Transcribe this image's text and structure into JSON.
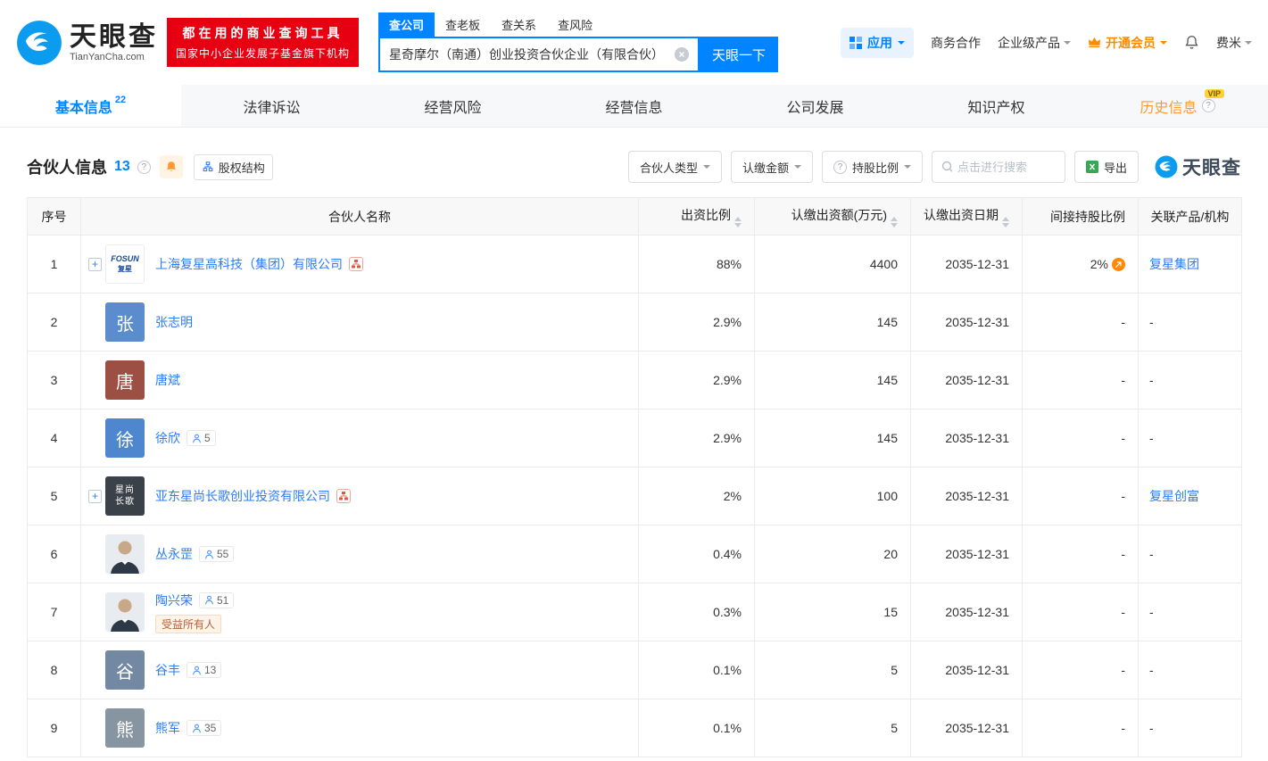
{
  "colors": {
    "primary": "#0084ff",
    "link": "#2b7cf7",
    "brand_red": "#e60012",
    "vip_orange": "#ff8a00"
  },
  "topbar": {
    "logo": {
      "title": "天眼查",
      "subtitle": "TianYanCha.com"
    },
    "slogan": {
      "line1": "都在用的商业查询工具",
      "line2": "国家中小企业发展子基金旗下机构"
    },
    "search": {
      "tabs": [
        {
          "label": "查公司",
          "active": true
        },
        {
          "label": "查老板",
          "active": false
        },
        {
          "label": "查关系",
          "active": false
        },
        {
          "label": "查风险",
          "active": false
        }
      ],
      "value": "星奇摩尔（南通）创业投资合伙企业（有限合伙）",
      "button_label": "天眼一下"
    },
    "right": {
      "apps_label": "应用",
      "biz_label": "商务合作",
      "enterprise_label": "企业级产品",
      "vip_label": "开通会员",
      "user_label": "费米"
    }
  },
  "nav_tabs": [
    {
      "label": "基本信息",
      "count": "22",
      "active": true
    },
    {
      "label": "法律诉讼"
    },
    {
      "label": "经营风险"
    },
    {
      "label": "经营信息"
    },
    {
      "label": "公司发展"
    },
    {
      "label": "知识产权"
    },
    {
      "label": "历史信息",
      "vip": true,
      "info": true
    }
  ],
  "section": {
    "title": "合伙人信息",
    "count": "13",
    "equity_structure_label": "股权结构",
    "filters": [
      {
        "label": "合伙人类型"
      },
      {
        "label": "认缴金额"
      },
      {
        "label": "持股比例",
        "help": true
      }
    ],
    "search_placeholder": "点击进行搜索",
    "export_label": "导出",
    "watermark": "天眼查"
  },
  "table": {
    "headers": [
      {
        "label": "序号"
      },
      {
        "label": "合伙人名称"
      },
      {
        "label": "出资比例",
        "sortable": true
      },
      {
        "label": "认缴出资额(万元)",
        "sortable": true
      },
      {
        "label": "认缴出资日期",
        "sortable": true
      },
      {
        "label": "间接持股比例"
      },
      {
        "label": "关联产品/机构"
      }
    ],
    "rows": [
      {
        "no": "1",
        "name": "上海复星高科技（集团）有限公司",
        "avatar": {
          "type": "logo-light",
          "lines": [
            "FOSUN",
            "复星"
          ]
        },
        "expand": true,
        "equity_icon": true,
        "ratio": "88%",
        "amount": "4400",
        "date": "2035-12-31",
        "indirect": "2%",
        "indirect_icon": true,
        "related": "复星集团"
      },
      {
        "no": "2",
        "name": "张志明",
        "avatar": {
          "type": "text",
          "lines": [
            "张"
          ],
          "bg": "#5a8cce"
        },
        "ratio": "2.9%",
        "amount": "145",
        "date": "2035-12-31",
        "indirect": "-",
        "related": "-"
      },
      {
        "no": "3",
        "name": "唐斌",
        "avatar": {
          "type": "text",
          "lines": [
            "唐"
          ],
          "bg": "#9c4f43"
        },
        "ratio": "2.9%",
        "amount": "145",
        "date": "2035-12-31",
        "indirect": "-",
        "related": "-"
      },
      {
        "no": "4",
        "name": "徐欣",
        "partners": "5",
        "avatar": {
          "type": "text",
          "lines": [
            "徐"
          ],
          "bg": "#4f87cf"
        },
        "ratio": "2.9%",
        "amount": "145",
        "date": "2035-12-31",
        "indirect": "-",
        "related": "-"
      },
      {
        "no": "5",
        "name": "亚东星尚长歌创业投资有限公司",
        "avatar": {
          "type": "logo-dark",
          "lines": [
            "星尚",
            "长歌"
          ],
          "bg": "#3b4148"
        },
        "expand": true,
        "equity_icon": true,
        "ratio": "2%",
        "amount": "100",
        "date": "2035-12-31",
        "indirect": "-",
        "related": "复星创富"
      },
      {
        "no": "6",
        "name": "丛永罡",
        "partners": "55",
        "avatar": {
          "type": "photo"
        },
        "ratio": "0.4%",
        "amount": "20",
        "date": "2035-12-31",
        "indirect": "-",
        "related": "-"
      },
      {
        "no": "7",
        "name": "陶兴荣",
        "partners": "51",
        "badge": "受益所有人",
        "avatar": {
          "type": "photo"
        },
        "ratio": "0.3%",
        "amount": "15",
        "date": "2035-12-31",
        "indirect": "-",
        "related": "-"
      },
      {
        "no": "8",
        "name": "谷丰",
        "partners": "13",
        "avatar": {
          "type": "text",
          "lines": [
            "谷"
          ],
          "bg": "#7388a3"
        },
        "ratio": "0.1%",
        "amount": "5",
        "date": "2035-12-31",
        "indirect": "-",
        "related": "-"
      },
      {
        "no": "9",
        "name": "熊军",
        "partners": "35",
        "avatar": {
          "type": "text",
          "lines": [
            "熊"
          ],
          "bg": "#8795a1"
        },
        "ratio": "0.1%",
        "amount": "5",
        "date": "2035-12-31",
        "indirect": "-",
        "related": "-"
      }
    ]
  }
}
